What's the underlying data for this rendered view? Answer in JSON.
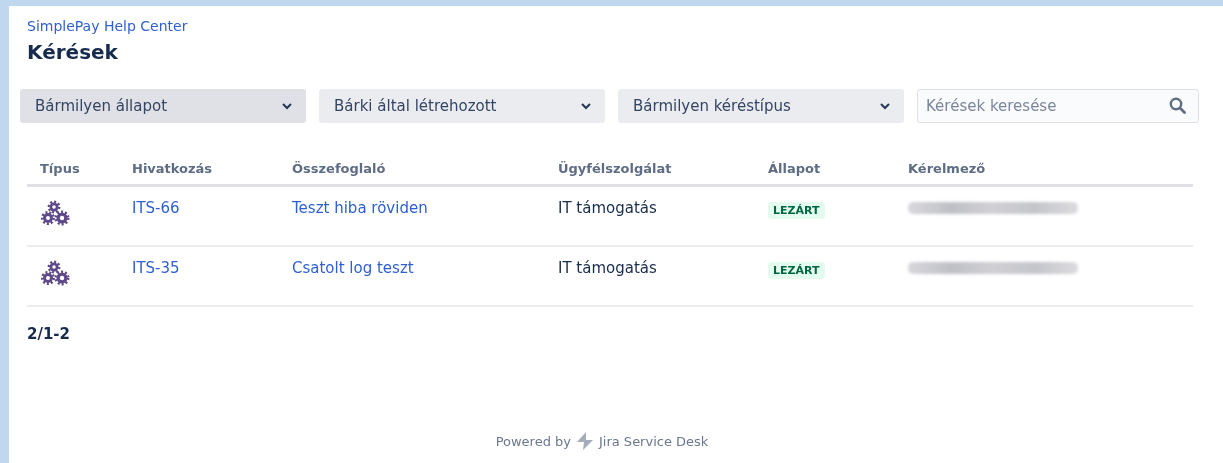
{
  "header": {
    "site_link": "SimplePay Help Center",
    "title": "Kérések"
  },
  "filters": [
    {
      "label": "Bármilyen állapot",
      "selected": true
    },
    {
      "label": "Bárki által létrehozott",
      "selected": false
    },
    {
      "label": "Bármilyen kéréstípus",
      "selected": false
    }
  ],
  "search": {
    "placeholder": "Kérések keresése"
  },
  "table": {
    "columns": [
      "Típus",
      "Hivatkozás",
      "Összefoglaló",
      "Ügyfélszolgálat",
      "Állapot",
      "Kérelmező"
    ],
    "rows": [
      {
        "reference": "ITS-66",
        "summary": "Teszt hiba röviden",
        "service_desk": "IT támogatás",
        "status": "LEZÁRT"
      },
      {
        "reference": "ITS-35",
        "summary": "Csatolt log teszt",
        "service_desk": "IT támogatás",
        "status": "LEZÁRT"
      }
    ]
  },
  "pagination": "2/1-2",
  "footer": {
    "prefix": "Powered by",
    "product": "Jira Service Desk"
  }
}
